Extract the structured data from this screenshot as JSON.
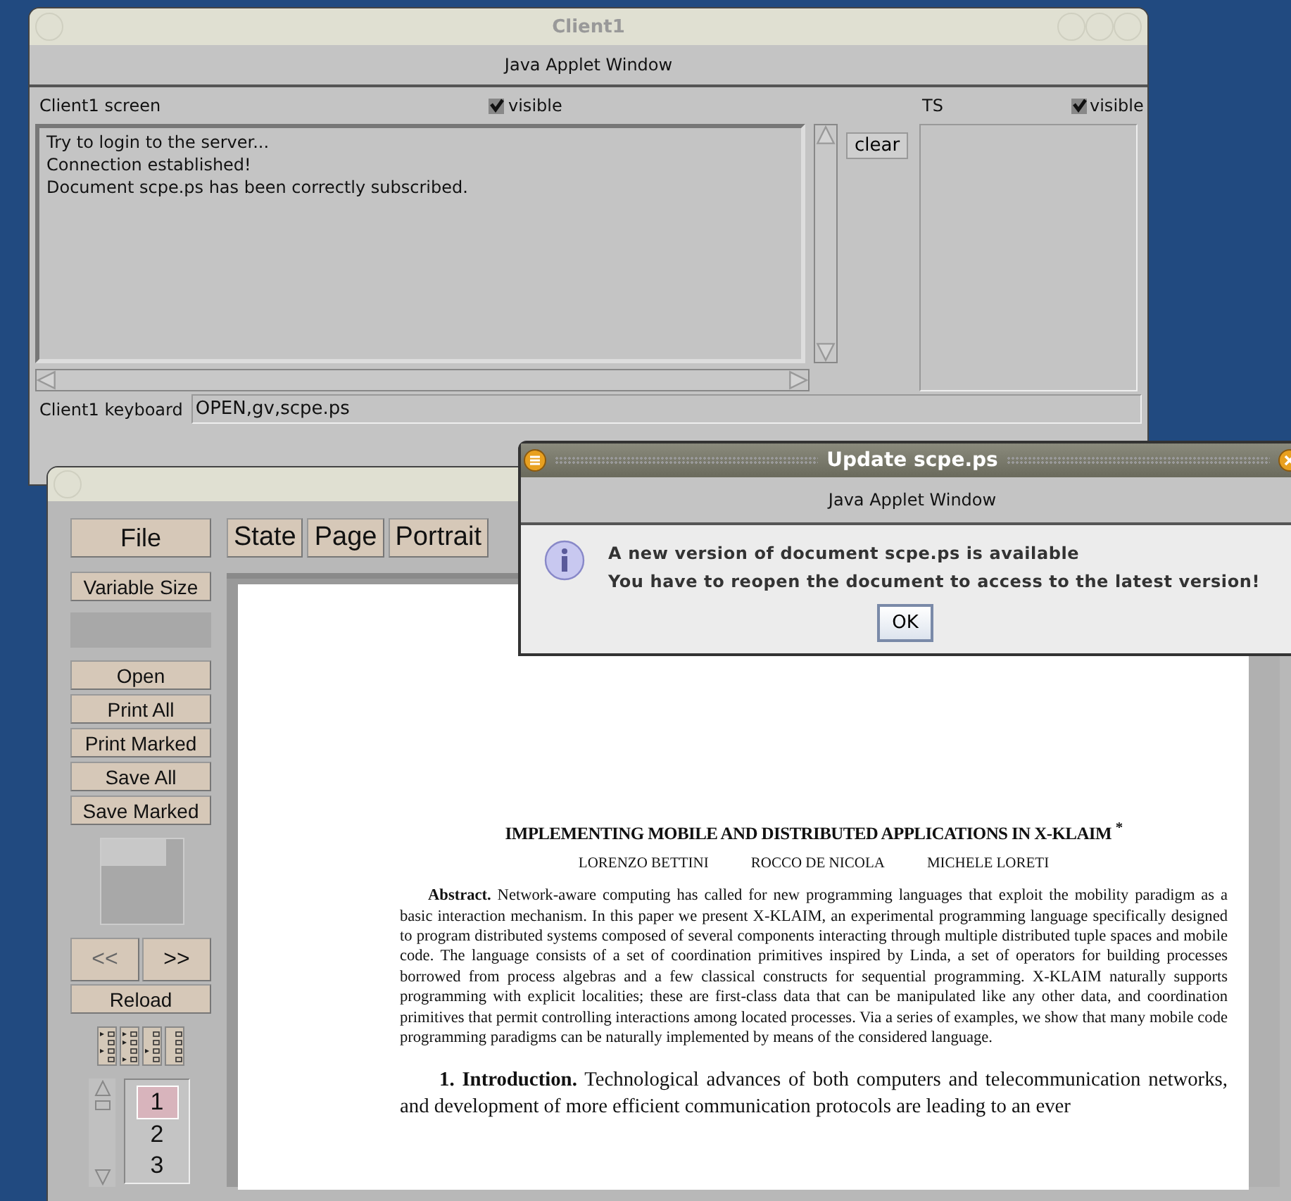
{
  "client_window": {
    "title": "Client1",
    "subtitle": "Java Applet Window",
    "screen_label": "Client1 screen",
    "screen_visible": {
      "label": "visible",
      "checked": true
    },
    "ts_label": "TS",
    "ts_visible": {
      "label": "visible",
      "checked": true
    },
    "log_lines": [
      "Try to login to the server...",
      "Connection established!",
      "Document scpe.ps has been correctly subscribed."
    ],
    "clear_button": "clear",
    "keyboard_label": "Client1 keyboard",
    "keyboard_value": "OPEN,gv,scpe.ps"
  },
  "viewer_window": {
    "menu_buttons": [
      "File",
      "State",
      "Page",
      "Portrait"
    ],
    "size_button": "Variable Size",
    "file_buttons": [
      "Open",
      "Print All",
      "Print Marked",
      "Save All",
      "Save Marked"
    ],
    "prev_button": "<<",
    "next_button": ">>",
    "reload_button": "Reload",
    "pages": [
      {
        "label": "1",
        "selected": true
      },
      {
        "label": "2",
        "selected": false
      },
      {
        "label": "3",
        "selected": false
      }
    ],
    "document": {
      "title": "IMPLEMENTING MOBILE AND DISTRIBUTED APPLICATIONS IN X-KLAIM $^{*}$",
      "authors": [
        "LORENZO BETTINI",
        "ROCCO DE NICOLA",
        "MICHELE LORETI"
      ],
      "abstract": "**Abstract.** Network-aware computing has called for new programming languages that exploit the mobility paradigm as a basic interaction mechanism. In this paper we present X-KLAIM, an experimental programming language specifically designed to program distributed systems composed of several components interacting through multiple distributed tuple spaces and mobile code. The language consists of a set of coordination primitives inspired by Linda, a set of operators for building processes borrowed from process algebras and a few classical constructs for sequential programming. X-KLAIM naturally supports programming with explicit localities; these are first-class data that can be manipulated like any other data, and coordination primitives that permit controlling interactions among located processes. Via a series of examples, we show that many mobile code programming paradigms can be naturally implemented by means of the considered language.",
      "intro": "**1. Introduction.** Technological advances of both computers and telecommunication networks, and development of more efficient communication protocols are leading to an ever"
    }
  },
  "dialog": {
    "title": "Update scpe.ps",
    "subtitle": "Java Applet Window",
    "lines": [
      "A new version of document scpe.ps is available",
      "You have to reopen the document to access to the latest version!"
    ],
    "ok_button": "OK"
  }
}
